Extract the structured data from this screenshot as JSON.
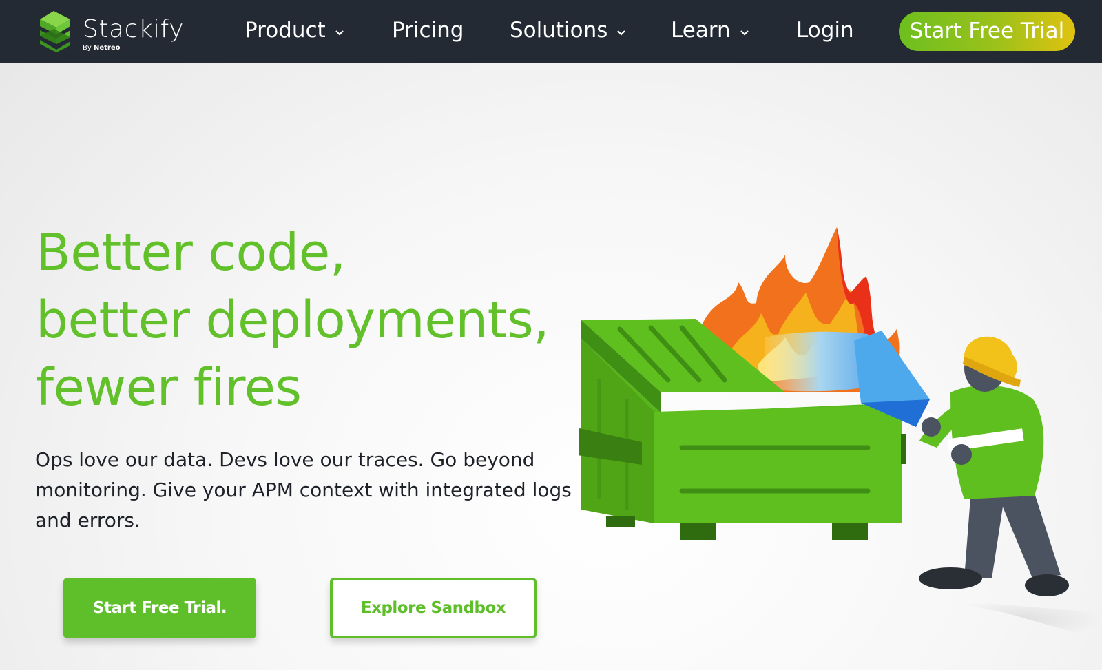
{
  "nav": {
    "logo": {
      "name": "Stackify",
      "by": "By",
      "by_brand": "Netreo"
    },
    "items": [
      {
        "label": "Product",
        "dropdown": true
      },
      {
        "label": "Pricing",
        "dropdown": false
      },
      {
        "label": "Solutions",
        "dropdown": true
      },
      {
        "label": "Learn",
        "dropdown": true
      },
      {
        "label": "Login",
        "dropdown": false
      }
    ],
    "cta": "Start Free Trial"
  },
  "hero": {
    "headline": [
      "Better code,",
      "better deployments,",
      "fewer fires"
    ],
    "subtext": "Ops love our data. Devs love our traces. Go beyond monitoring. Give your APM context with integrated logs and errors.",
    "primary_button": "Start Free Trial.",
    "secondary_button": "Explore Sandbox",
    "illustration": "firefighter-dumpster-fire-illustration"
  },
  "colors": {
    "nav_bg": "#232a33",
    "brand_green": "#5fbf2a",
    "cta_gradient_start": "#6cbf1f",
    "cta_gradient_end": "#e0c210",
    "body_text": "#1e2228"
  },
  "icons": [
    "stackify-logo-icon",
    "chevron-down-icon"
  ]
}
